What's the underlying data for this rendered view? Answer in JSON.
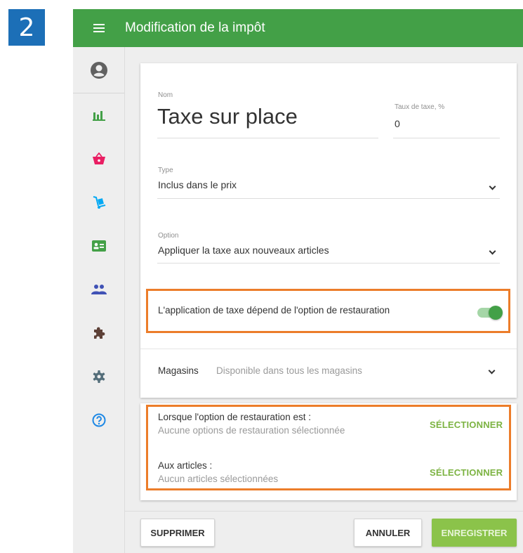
{
  "step_number": "2",
  "topbar": {
    "title": "Modification de la impôt",
    "menu_icon": "menu-icon"
  },
  "sidebar": {
    "avatar_icon": "account-circle-icon",
    "items": [
      {
        "icon": "bar-chart-icon",
        "color": "#43a047"
      },
      {
        "icon": "basket-icon",
        "color": "#e91e63"
      },
      {
        "icon": "hand-truck-icon",
        "color": "#03a9f4"
      },
      {
        "icon": "id-card-icon",
        "color": "#43a047"
      },
      {
        "icon": "people-icon",
        "color": "#3f51b5"
      },
      {
        "icon": "puzzle-icon",
        "color": "#5d4037"
      },
      {
        "icon": "gear-icon",
        "color": "#546e7a"
      },
      {
        "icon": "help-circle-icon",
        "color": "#1e88e5"
      }
    ]
  },
  "form": {
    "name_label": "Nom",
    "name_value": "Taxe sur place",
    "rate_label": "Taux de taxe, %",
    "rate_value": "0",
    "type_label": "Type",
    "type_value": "Inclus dans le prix",
    "option_label": "Option",
    "option_value": "Appliquer la taxe aux nouveaux articles",
    "toggle_label": "L'application de taxe dépend de l'option de restauration",
    "toggle_on": true,
    "stores_label": "Magasins",
    "stores_value": "Disponible dans tous les magasins"
  },
  "conditions": {
    "dining_title": "Lorsque l'option de restauration est :",
    "dining_value": "Aucune options de restauration sélectionnée",
    "dining_button": "SÉLECTIONNER",
    "items_title": "Aux articles :",
    "items_value": "Aucun articles sélectionnées",
    "items_button": "SÉLECTIONNER"
  },
  "actions": {
    "delete": "SUPPRIMER",
    "cancel": "ANNULER",
    "save": "ENREGISTRER"
  },
  "colors": {
    "primary": "#43a047",
    "accent_button": "#8bc34a",
    "highlight": "#ec7d2a",
    "badge": "#1c6fb7"
  }
}
